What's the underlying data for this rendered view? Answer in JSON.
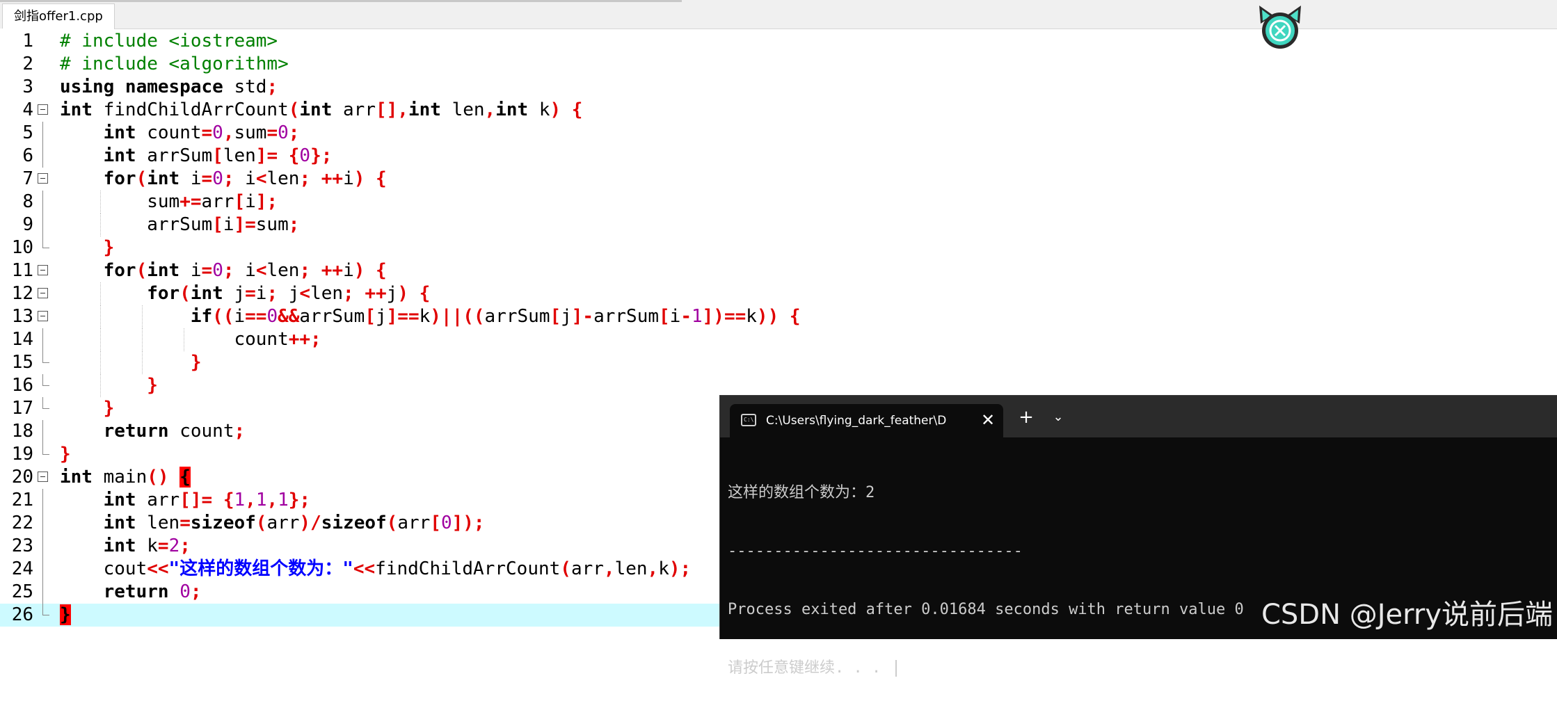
{
  "editor": {
    "tab_label": "剑指offer1.cpp",
    "lines": [
      {
        "num": "1"
      },
      {
        "num": "2"
      },
      {
        "num": "3"
      },
      {
        "num": "4"
      },
      {
        "num": "5"
      },
      {
        "num": "6"
      },
      {
        "num": "7"
      },
      {
        "num": "8"
      },
      {
        "num": "9"
      },
      {
        "num": "10"
      },
      {
        "num": "11"
      },
      {
        "num": "12"
      },
      {
        "num": "13"
      },
      {
        "num": "14"
      },
      {
        "num": "15"
      },
      {
        "num": "16"
      },
      {
        "num": "17"
      },
      {
        "num": "18"
      },
      {
        "num": "19"
      },
      {
        "num": "20"
      },
      {
        "num": "21"
      },
      {
        "num": "22"
      },
      {
        "num": "23"
      },
      {
        "num": "24"
      },
      {
        "num": "25"
      },
      {
        "num": "26"
      }
    ],
    "code": {
      "l1": "# include <iostream>",
      "l2": "# include <algorithm>",
      "l24_string": "\"这样的数组个数为：\""
    }
  },
  "terminal": {
    "tab_title": "C:\\Users\\flying_dark_feather\\D",
    "close_glyph": "✕",
    "new_tab_glyph": "+",
    "dropdown_glyph": "⌄",
    "output": [
      "这样的数组个数为：2",
      "--------------------------------",
      "Process exited after 0.01684 seconds with return value 0",
      "请按任意键继续. . . "
    ]
  },
  "watermark": "CSDN @Jerry说前后端",
  "colors": {
    "keyword": "#000000",
    "operator": "#e00000",
    "number": "#a000a0",
    "string": "#0000ff",
    "preprocessor": "#008000",
    "current_line": "#cdfaff",
    "terminal_bg": "#0c0c0c"
  }
}
